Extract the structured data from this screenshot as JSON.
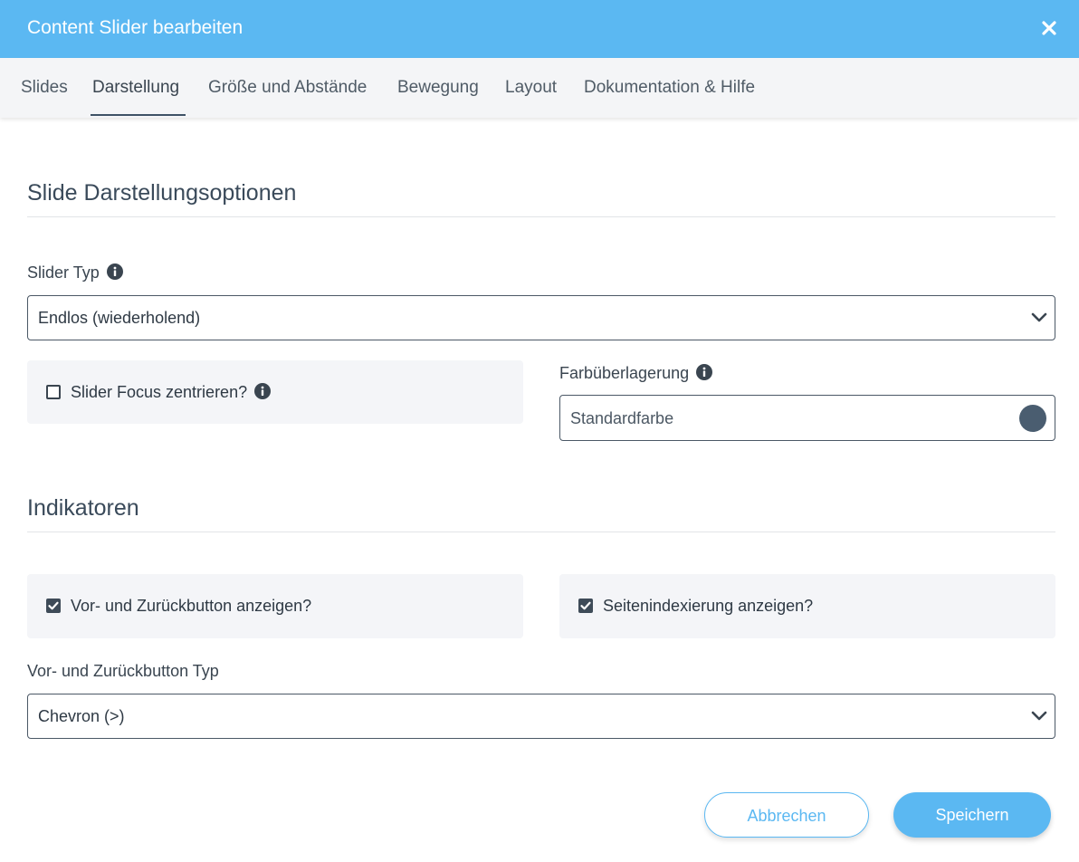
{
  "dialog": {
    "title": "Content Slider bearbeiten"
  },
  "tabs": [
    {
      "label": "Slides"
    },
    {
      "label": "Darstellung"
    },
    {
      "label": "Größe und Abstände"
    },
    {
      "label": "Bewegung"
    },
    {
      "label": "Layout"
    },
    {
      "label": "Dokumentation & Hilfe"
    }
  ],
  "active_tab": "Darstellung",
  "section_display": {
    "title": "Slide Darstellungsoptionen",
    "slider_type": {
      "label": "Slider Typ",
      "value": "Endlos (wiederholend)"
    },
    "center_focus": {
      "label": "Slider Focus zentrieren?",
      "checked": false
    },
    "color_overlay": {
      "label": "Farbüberlagerung",
      "value": "Standardfarbe",
      "swatch_color": "#4a5d70"
    }
  },
  "section_indicators": {
    "title": "Indikatoren",
    "show_nav_buttons": {
      "label": "Vor- und Zurückbutton anzeigen?",
      "checked": true
    },
    "show_pagination": {
      "label": "Seitenindexierung anzeigen?",
      "checked": true
    },
    "nav_button_type": {
      "label": "Vor- und Zurückbutton Typ",
      "value": "Chevron (>)"
    }
  },
  "footer": {
    "cancel_label": "Abbrechen",
    "save_label": "Speichern"
  },
  "colors": {
    "accent": "#5bb8f2",
    "tab_underline": "#3e5266",
    "checkbox": "#3e4b58",
    "panel_bg": "#f4f5f8"
  }
}
